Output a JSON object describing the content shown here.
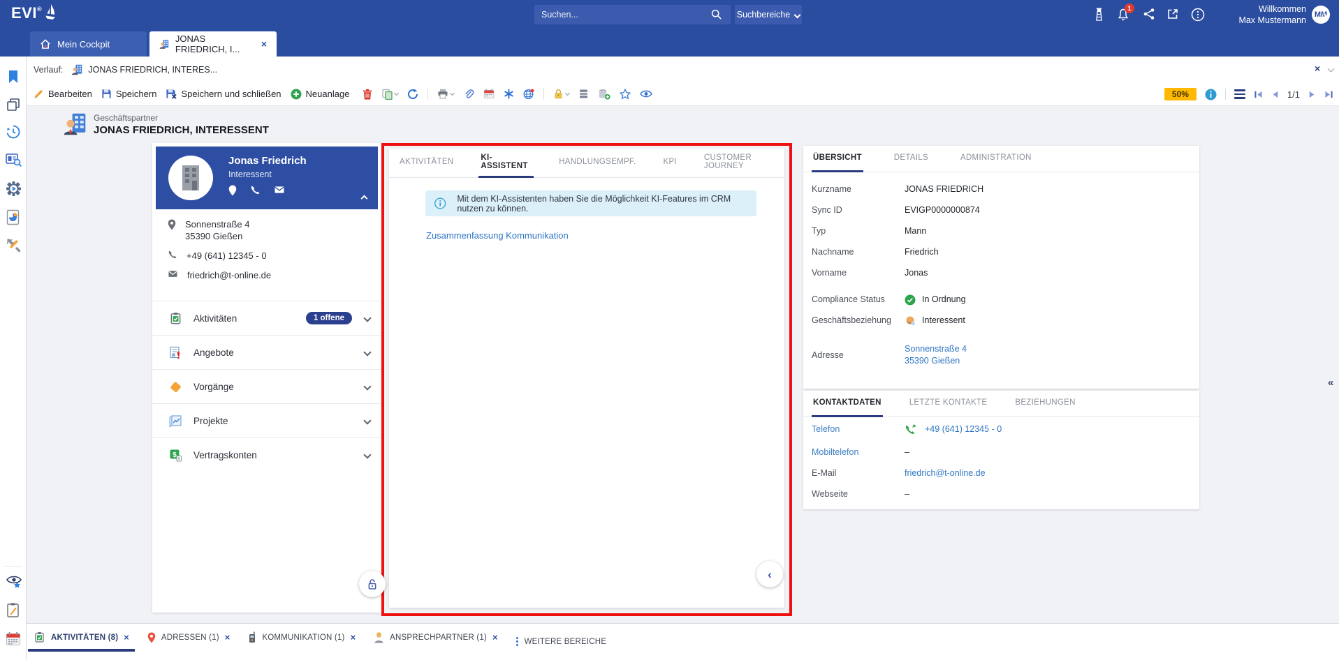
{
  "header": {
    "logo": "EVI",
    "search_placeholder": "Suchen...",
    "scope_label": "Suchbereiche",
    "welcome_line1": "Willkommen",
    "welcome_line2": "Max Mustermann",
    "avatar_initials": "MM",
    "notification_count": "1"
  },
  "window_tabs": [
    {
      "label": "Mein Cockpit"
    },
    {
      "label": "JONAS FRIEDRICH, I..."
    }
  ],
  "history": {
    "label": "Verlauf:",
    "entry": "JONAS FRIEDRICH, INTERES..."
  },
  "toolbar": {
    "edit": "Bearbeiten",
    "save": "Speichern",
    "save_close": "Speichern und schließen",
    "new": "Neuanlage",
    "progress": "50%",
    "page_indicator": "1/1"
  },
  "record": {
    "kind": "Geschäftspartner",
    "title": "JONAS FRIEDRICH, INTERESSENT"
  },
  "profile": {
    "name": "Jonas Friedrich",
    "relation": "Interessent",
    "street": "Sonnenstraße 4",
    "city": "35390 Gießen",
    "phone": "+49 (641) 12345 - 0",
    "email": "friedrich@t-online.de"
  },
  "accordion": [
    {
      "label": "Aktivitäten",
      "badge": "1 offene"
    },
    {
      "label": "Angebote"
    },
    {
      "label": "Vorgänge"
    },
    {
      "label": "Projekte"
    },
    {
      "label": "Vertragskonten"
    }
  ],
  "center": {
    "tabs": [
      "AKTIVITÄTEN",
      "KI-ASSISTENT",
      "HANDLUNGSEMPF.",
      "KPI",
      "CUSTOMER JOURNEY"
    ],
    "info_message": "Mit dem KI-Assistenten haben Sie die Möglichkeit KI-Features im CRM nutzen zu können.",
    "link": "Zusammenfassung Kommunikation"
  },
  "overview_card": {
    "tabs": [
      "ÜBERSICHT",
      "DETAILS",
      "ADMINISTRATION"
    ],
    "rows": [
      {
        "label": "Kurzname",
        "value": "JONAS FRIEDRICH"
      },
      {
        "label": "Sync ID",
        "value": "EVIGP0000000874"
      },
      {
        "label": "Typ",
        "value": "Mann"
      },
      {
        "label": "Nachname",
        "value": "Friedrich"
      },
      {
        "label": "Vorname",
        "value": "Jonas"
      }
    ],
    "compliance": {
      "label": "Compliance Status",
      "value": "In Ordnung"
    },
    "relation": {
      "label": "Geschäftsbeziehung",
      "value": "Interessent"
    },
    "address": {
      "label": "Adresse",
      "line1": "Sonnenstraße 4",
      "line2": "35390 Gießen"
    }
  },
  "contact_card": {
    "tabs": [
      "KONTAKTDATEN",
      "LETZTE KONTAKTE",
      "BEZIEHUNGEN"
    ],
    "rows": [
      {
        "label": "Telefon",
        "value": "+49 (641) 12345 - 0"
      },
      {
        "label": "Mobiltelefon",
        "value": "–"
      },
      {
        "label": "E-Mail",
        "value": "friedrich@t-online.de"
      },
      {
        "label": "Webseite",
        "value": "–"
      }
    ]
  },
  "footer": {
    "tabs": [
      {
        "label": "AKTIVITÄTEN (8)"
      },
      {
        "label": "ADRESSEN (1)"
      },
      {
        "label": "KOMMUNIKATION (1)"
      },
      {
        "label": "ANSPRECHPARTNER (1)"
      }
    ],
    "more_label": "WEITERE BEREICHE"
  },
  "icons": {
    "close": "×",
    "collapse_left": "‹",
    "double_left": "«"
  },
  "colors": {
    "header_blue": "#2b4da0",
    "card_blue": "#2e4ea3",
    "navy_accent": "#2b3c7e",
    "link_blue": "#2e75c5",
    "highlight_red": "#ee1111",
    "progress_amber": "#ffb900",
    "status_green": "#2da44e"
  }
}
